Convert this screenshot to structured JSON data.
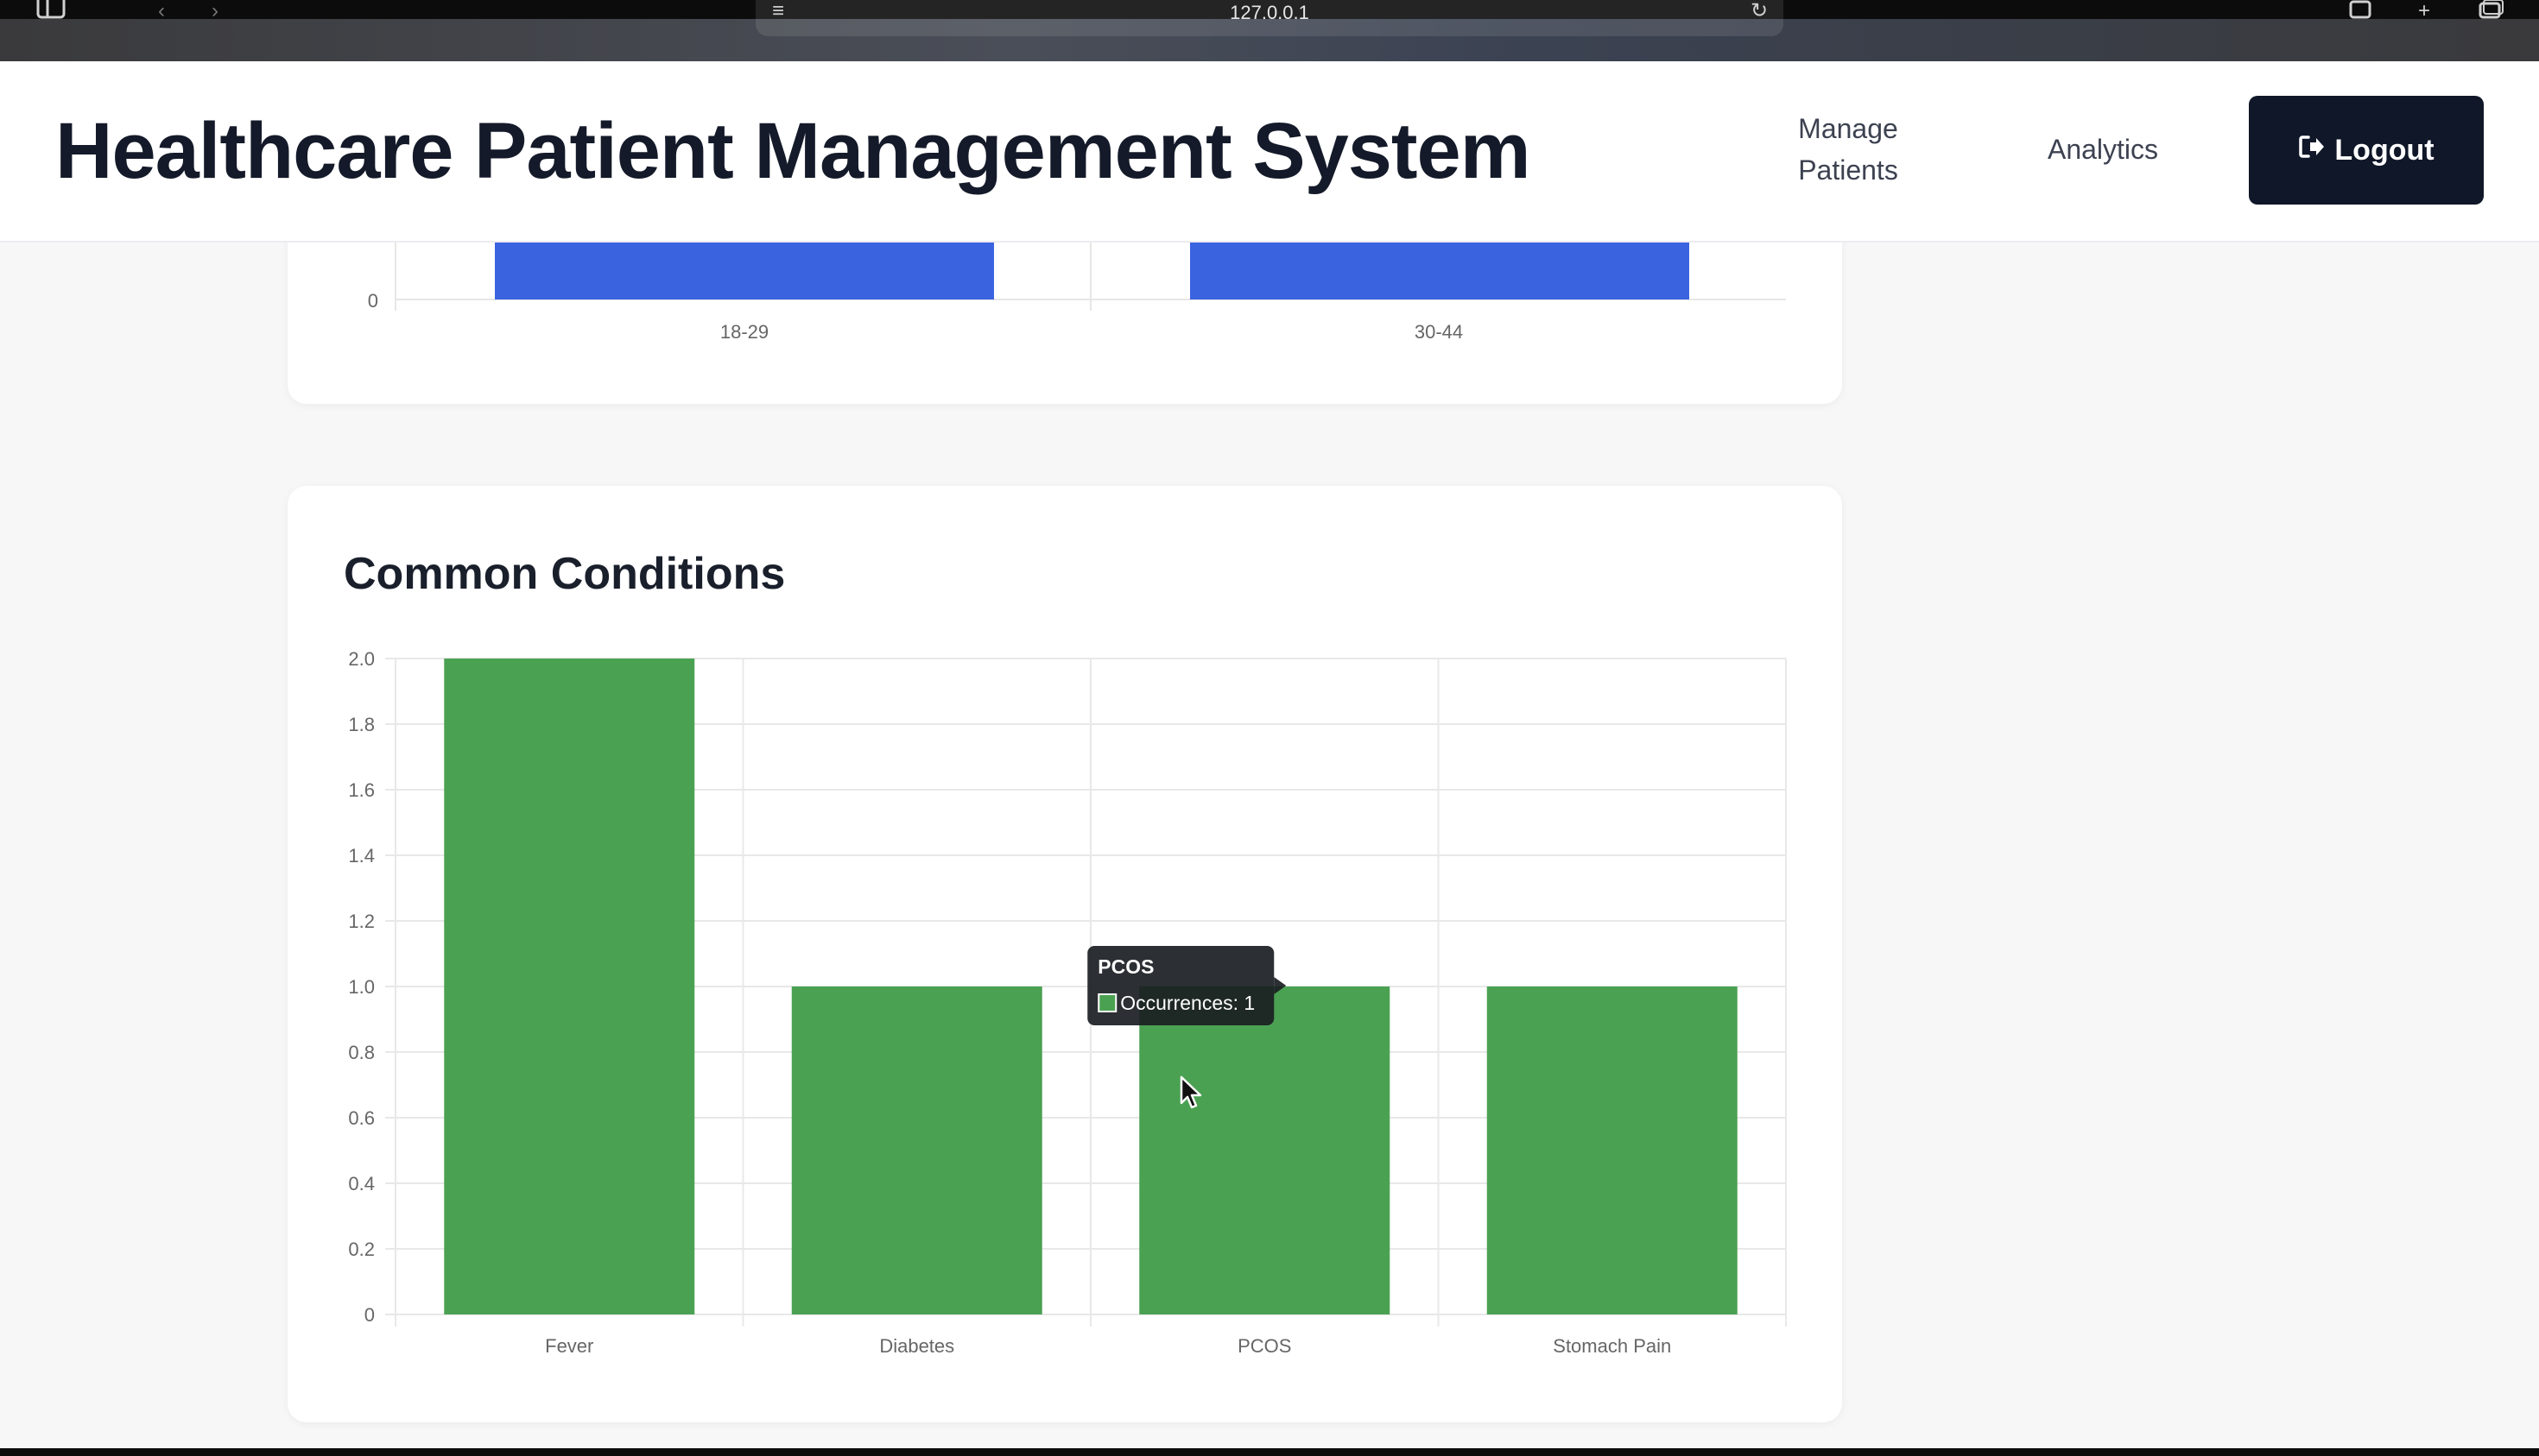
{
  "browser": {
    "url": "127.0.0.1"
  },
  "header": {
    "title": "Healthcare Patient Management System",
    "nav": {
      "manage_line1": "Manage",
      "manage_line2": "Patients",
      "analytics": "Analytics"
    },
    "logout_label": "Logout"
  },
  "age_chart": {
    "y_tick_visible": "0",
    "categories": [
      "18-29",
      "30-44"
    ],
    "bar_color": "#3a63e0"
  },
  "conditions": {
    "title": "Common Conditions",
    "tooltip": {
      "title": "PCOS",
      "label": "Occurrences: 1"
    }
  },
  "chart_data": {
    "type": "bar",
    "title": "Common Conditions",
    "categories": [
      "Fever",
      "Diabetes",
      "PCOS",
      "Stomach Pain"
    ],
    "series": [
      {
        "name": "Occurrences",
        "values": [
          2,
          1,
          1,
          1
        ]
      }
    ],
    "ylim": [
      0,
      2.0
    ],
    "yticks": [
      "0",
      "0.2",
      "0.4",
      "0.6",
      "0.8",
      "1.0",
      "1.2",
      "1.4",
      "1.6",
      "1.8",
      "2.0"
    ],
    "grid": true,
    "bar_color": "#4ba152"
  }
}
